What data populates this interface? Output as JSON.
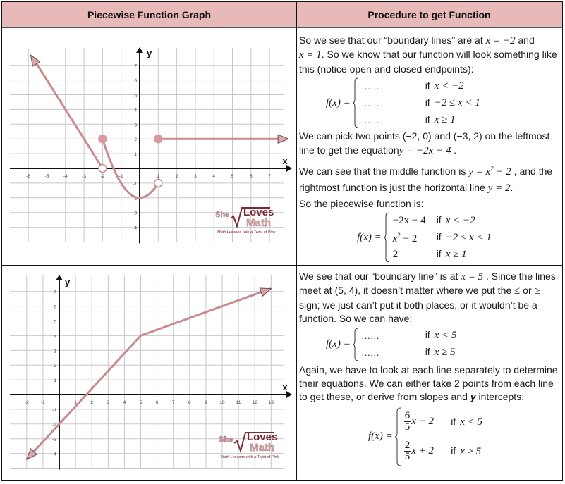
{
  "header": {
    "left_title": "Piecewise Function Graph",
    "right_title": "Procedure to get Function",
    "background_color": "#e8b9b9"
  },
  "colors": {
    "curve": "#c98a8e",
    "curve_dark": "#8c5a60",
    "grid": "#c8c8c8",
    "axis": "#111111"
  },
  "watermark": {
    "word1": "She",
    "word2": "Loves",
    "word3": "Math",
    "tagline": "Math Lessons with a Twist of Pink"
  },
  "row1": {
    "graph": {
      "x_label": "x",
      "y_label": "y",
      "x_ticks": [
        "-6",
        "-5",
        "-4",
        "-3",
        "-2",
        "-1",
        "1",
        "2",
        "3",
        "4",
        "5",
        "6",
        "7"
      ],
      "y_ticks": [
        "7",
        "6",
        "5",
        "4",
        "3",
        "2",
        "1",
        "-1",
        "-2",
        "-3",
        "-4"
      ],
      "x_range": [
        -6,
        7
      ],
      "y_range": [
        -5,
        7
      ],
      "pieces": [
        {
          "name": "left-line",
          "equation": "y = -2x - 4",
          "domain": "x < -2",
          "from": [
            -2,
            0
          ],
          "to": [
            -5.8,
            7.6
          ],
          "arrow": "end"
        },
        {
          "name": "middle-parabola",
          "equation": "y = x^2 - 2",
          "domain": "-2 <= x < 1",
          "from": [
            -2,
            2
          ],
          "to": [
            1,
            -1
          ]
        },
        {
          "name": "right-line",
          "equation": "y = 2",
          "domain": "x >= 1",
          "from": [
            1,
            2
          ],
          "to": [
            7.8,
            2
          ],
          "arrow": "end"
        }
      ],
      "endpoints": [
        {
          "point": [
            -2,
            0
          ],
          "type": "open"
        },
        {
          "point": [
            -2,
            2
          ],
          "type": "closed"
        },
        {
          "point": [
            1,
            2
          ],
          "type": "closed"
        },
        {
          "point": [
            1,
            -1
          ],
          "type": "open"
        }
      ]
    },
    "text": {
      "p1_a": "So we see that our “boundary lines” are at ",
      "p1_m1": "x = −2",
      "p1_b": " and",
      "p1_m2": "x = 1",
      "p1_c": ".  So we know that our function will look something like this (notice open and closed endpoints):",
      "fx": "f(x) =",
      "template_rows": [
        {
          "expr": "......",
          "if": "if",
          "cond": "x < −2"
        },
        {
          "expr": "......",
          "if": "if",
          "cond": "−2 ≤ x < 1"
        },
        {
          "expr": "......",
          "if": "if",
          "cond": "x ≥ 1"
        }
      ],
      "p2_a": "We can pick two points (−2, 0) and (−3, 2) on the leftmost line to get the equation",
      "p2_m": "y = −2x − 4",
      "p2_b": " .",
      "p3_a": "We can see that the middle function is ",
      "p3_m1": "y = x",
      "p3_m1_sup": "2",
      "p3_m1_tail": " − 2",
      "p3_b": " , and the rightmost function is just the horizontal line ",
      "p3_m2": "y = 2",
      "p3_c": ".",
      "p4": "So the piecewise function is:",
      "final_rows": [
        {
          "expr": "−2x − 4",
          "if": "if",
          "cond": "x < −2"
        },
        {
          "expr": "x",
          "expr_sup": "2",
          "expr_tail": " − 2",
          "if": "if",
          "cond": "−2 ≤ x < 1"
        },
        {
          "expr": "2",
          "if": "if",
          "cond": "x ≥ 1"
        }
      ]
    }
  },
  "row2": {
    "graph": {
      "x_label": "x",
      "y_label": "y",
      "x_ticks": [
        "-2",
        "-1",
        "1",
        "2",
        "3",
        "4",
        "5",
        "6",
        "7",
        "8",
        "9",
        "10",
        "11",
        "12",
        "13"
      ],
      "y_ticks": [
        "7",
        "6",
        "5",
        "4",
        "3",
        "2",
        "1",
        "-1",
        "-2",
        "-3",
        "-4"
      ],
      "x_range": [
        -2,
        13
      ],
      "y_range": [
        -5,
        7
      ],
      "pieces": [
        {
          "name": "left-line",
          "equation": "y = 6/5 x - 2",
          "domain": "x < 5",
          "from": [
            5,
            4
          ],
          "to": [
            -2,
            -4.4
          ],
          "arrow": "end"
        },
        {
          "name": "right-line",
          "equation": "y = 2/5 x + 2",
          "domain": "x >= 5",
          "from": [
            5,
            4
          ],
          "to": [
            13,
            7.2
          ],
          "arrow": "end"
        }
      ],
      "vertex": [
        5,
        4
      ]
    },
    "text": {
      "p1_a": "We see that our “boundary line” is at ",
      "p1_m": "x = 5",
      "p1_b": " .  Since the lines meet at (5, 4), it doesn’t matter where we put the ",
      "p1_le": "≤",
      "p1_c": " or  ",
      "p1_ge": "≥",
      "p1_d": " sign; we just can’t put it both places, or it wouldn’t be a function.  So we can have:",
      "fx": "f(x) =",
      "template_rows": [
        {
          "expr": "......",
          "if": "if",
          "cond": "x < 5"
        },
        {
          "expr": "......",
          "if": "if",
          "cond": "x ≥ 5"
        }
      ],
      "p2_a": "Again, we have to look at each line separately to determine their equations.  We can either take 2 points from each line to get these, or derive from slopes and ",
      "p2_bold": "y",
      "p2_b": " intercepts:",
      "final_rows": [
        {
          "num": "6",
          "den": "5",
          "expr_tail": "x − 2",
          "if": "if",
          "cond": "x < 5"
        },
        {
          "num": "2",
          "den": "5",
          "expr_tail": "x + 2",
          "if": "if",
          "cond": "x ≥ 5"
        }
      ]
    }
  }
}
